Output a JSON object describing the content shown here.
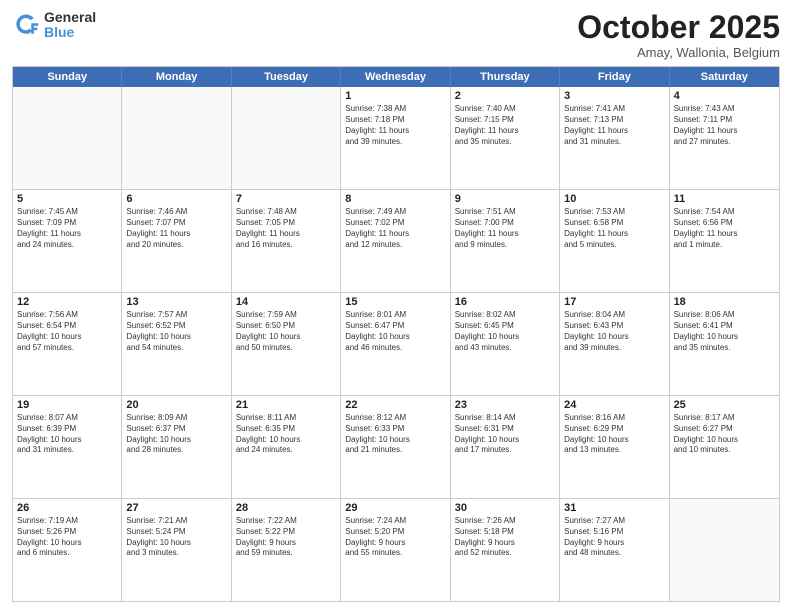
{
  "logo": {
    "general": "General",
    "blue": "Blue"
  },
  "title": "October 2025",
  "subtitle": "Amay, Wallonia, Belgium",
  "headers": [
    "Sunday",
    "Monday",
    "Tuesday",
    "Wednesday",
    "Thursday",
    "Friday",
    "Saturday"
  ],
  "weeks": [
    [
      {
        "day": "",
        "info": ""
      },
      {
        "day": "",
        "info": ""
      },
      {
        "day": "",
        "info": ""
      },
      {
        "day": "1",
        "info": "Sunrise: 7:38 AM\nSunset: 7:18 PM\nDaylight: 11 hours\nand 39 minutes."
      },
      {
        "day": "2",
        "info": "Sunrise: 7:40 AM\nSunset: 7:15 PM\nDaylight: 11 hours\nand 35 minutes."
      },
      {
        "day": "3",
        "info": "Sunrise: 7:41 AM\nSunset: 7:13 PM\nDaylight: 11 hours\nand 31 minutes."
      },
      {
        "day": "4",
        "info": "Sunrise: 7:43 AM\nSunset: 7:11 PM\nDaylight: 11 hours\nand 27 minutes."
      }
    ],
    [
      {
        "day": "5",
        "info": "Sunrise: 7:45 AM\nSunset: 7:09 PM\nDaylight: 11 hours\nand 24 minutes."
      },
      {
        "day": "6",
        "info": "Sunrise: 7:46 AM\nSunset: 7:07 PM\nDaylight: 11 hours\nand 20 minutes."
      },
      {
        "day": "7",
        "info": "Sunrise: 7:48 AM\nSunset: 7:05 PM\nDaylight: 11 hours\nand 16 minutes."
      },
      {
        "day": "8",
        "info": "Sunrise: 7:49 AM\nSunset: 7:02 PM\nDaylight: 11 hours\nand 12 minutes."
      },
      {
        "day": "9",
        "info": "Sunrise: 7:51 AM\nSunset: 7:00 PM\nDaylight: 11 hours\nand 9 minutes."
      },
      {
        "day": "10",
        "info": "Sunrise: 7:53 AM\nSunset: 6:58 PM\nDaylight: 11 hours\nand 5 minutes."
      },
      {
        "day": "11",
        "info": "Sunrise: 7:54 AM\nSunset: 6:56 PM\nDaylight: 11 hours\nand 1 minute."
      }
    ],
    [
      {
        "day": "12",
        "info": "Sunrise: 7:56 AM\nSunset: 6:54 PM\nDaylight: 10 hours\nand 57 minutes."
      },
      {
        "day": "13",
        "info": "Sunrise: 7:57 AM\nSunset: 6:52 PM\nDaylight: 10 hours\nand 54 minutes."
      },
      {
        "day": "14",
        "info": "Sunrise: 7:59 AM\nSunset: 6:50 PM\nDaylight: 10 hours\nand 50 minutes."
      },
      {
        "day": "15",
        "info": "Sunrise: 8:01 AM\nSunset: 6:47 PM\nDaylight: 10 hours\nand 46 minutes."
      },
      {
        "day": "16",
        "info": "Sunrise: 8:02 AM\nSunset: 6:45 PM\nDaylight: 10 hours\nand 43 minutes."
      },
      {
        "day": "17",
        "info": "Sunrise: 8:04 AM\nSunset: 6:43 PM\nDaylight: 10 hours\nand 39 minutes."
      },
      {
        "day": "18",
        "info": "Sunrise: 8:06 AM\nSunset: 6:41 PM\nDaylight: 10 hours\nand 35 minutes."
      }
    ],
    [
      {
        "day": "19",
        "info": "Sunrise: 8:07 AM\nSunset: 6:39 PM\nDaylight: 10 hours\nand 31 minutes."
      },
      {
        "day": "20",
        "info": "Sunrise: 8:09 AM\nSunset: 6:37 PM\nDaylight: 10 hours\nand 28 minutes."
      },
      {
        "day": "21",
        "info": "Sunrise: 8:11 AM\nSunset: 6:35 PM\nDaylight: 10 hours\nand 24 minutes."
      },
      {
        "day": "22",
        "info": "Sunrise: 8:12 AM\nSunset: 6:33 PM\nDaylight: 10 hours\nand 21 minutes."
      },
      {
        "day": "23",
        "info": "Sunrise: 8:14 AM\nSunset: 6:31 PM\nDaylight: 10 hours\nand 17 minutes."
      },
      {
        "day": "24",
        "info": "Sunrise: 8:16 AM\nSunset: 6:29 PM\nDaylight: 10 hours\nand 13 minutes."
      },
      {
        "day": "25",
        "info": "Sunrise: 8:17 AM\nSunset: 6:27 PM\nDaylight: 10 hours\nand 10 minutes."
      }
    ],
    [
      {
        "day": "26",
        "info": "Sunrise: 7:19 AM\nSunset: 5:26 PM\nDaylight: 10 hours\nand 6 minutes."
      },
      {
        "day": "27",
        "info": "Sunrise: 7:21 AM\nSunset: 5:24 PM\nDaylight: 10 hours\nand 3 minutes."
      },
      {
        "day": "28",
        "info": "Sunrise: 7:22 AM\nSunset: 5:22 PM\nDaylight: 9 hours\nand 59 minutes."
      },
      {
        "day": "29",
        "info": "Sunrise: 7:24 AM\nSunset: 5:20 PM\nDaylight: 9 hours\nand 55 minutes."
      },
      {
        "day": "30",
        "info": "Sunrise: 7:26 AM\nSunset: 5:18 PM\nDaylight: 9 hours\nand 52 minutes."
      },
      {
        "day": "31",
        "info": "Sunrise: 7:27 AM\nSunset: 5:16 PM\nDaylight: 9 hours\nand 48 minutes."
      },
      {
        "day": "",
        "info": ""
      }
    ]
  ]
}
